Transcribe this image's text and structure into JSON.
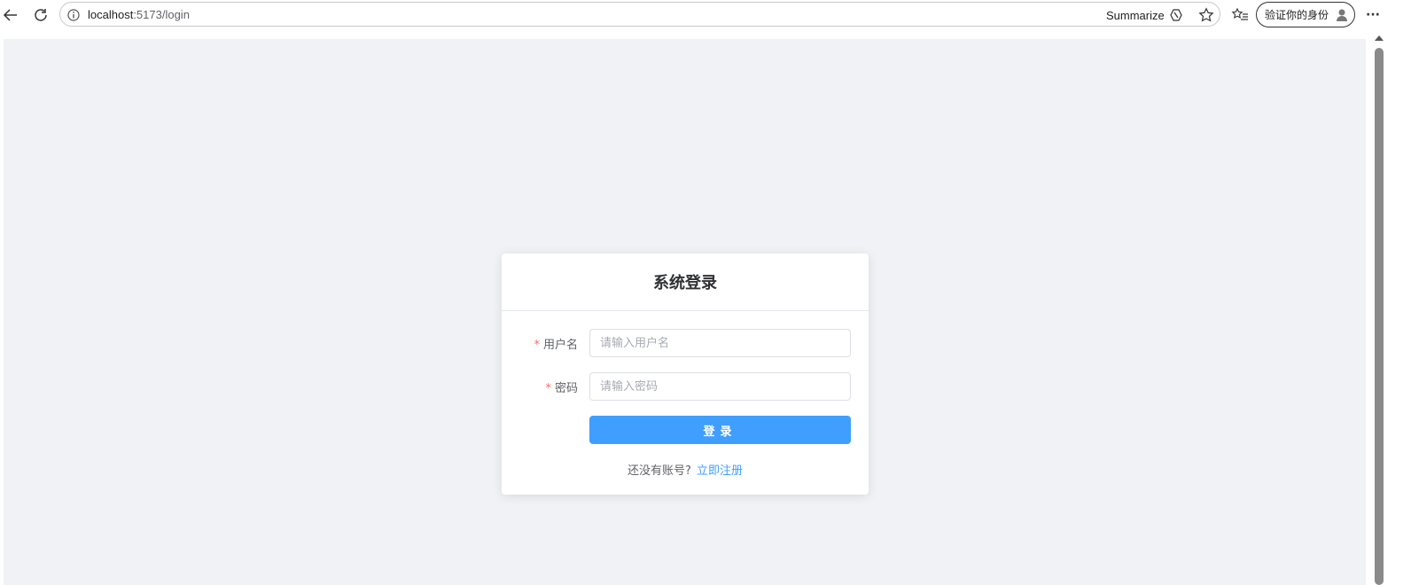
{
  "browser": {
    "url_host": "localhost",
    "url_path": ":5173/login",
    "summarize_label": "Summarize",
    "profile_label": "验证你的身份",
    "more_label": "···"
  },
  "login": {
    "title": "系统登录",
    "username_label": "用户名",
    "username_placeholder": "请输入用户名",
    "password_label": "密码",
    "password_placeholder": "请输入密码",
    "required_mark": "*",
    "submit_label": "登录",
    "register_prompt": "还没有账号?",
    "register_link": "立即注册"
  },
  "colors": {
    "primary": "#409eff",
    "required": "#f56c6c",
    "page_bg": "#f0f2f5"
  }
}
